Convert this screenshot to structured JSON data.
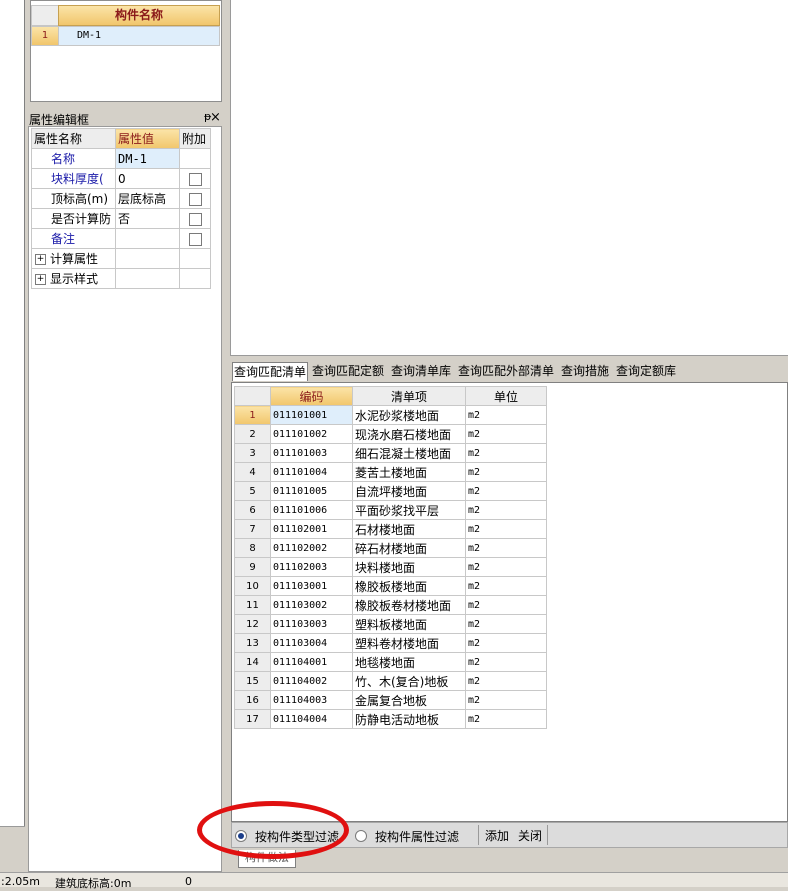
{
  "component_list": {
    "header": "构件名称",
    "rows": [
      {
        "num": "1",
        "name": "DM-1"
      }
    ]
  },
  "property_editor": {
    "title": "属性编辑框",
    "pin_glyph": "ᵽ",
    "close_glyph": "×",
    "col_name": "属性名称",
    "col_value": "属性值",
    "col_extra": "附加",
    "rows": [
      {
        "name": "名称",
        "value": "DM-1"
      },
      {
        "name": "块料厚度(",
        "value": "0"
      },
      {
        "name": "顶标高(m)",
        "value": "层底标高"
      },
      {
        "name": "是否计算防",
        "value": "否"
      },
      {
        "name": "备注",
        "value": ""
      }
    ],
    "groups": [
      {
        "label": "计算属性"
      },
      {
        "label": "显示样式"
      }
    ]
  },
  "query_tabs": [
    "查询匹配清单",
    "查询匹配定额",
    "查询清单库",
    "查询匹配外部清单",
    "查询措施",
    "查询定额库"
  ],
  "bill_table": {
    "headers": {
      "code": "编码",
      "item": "清单项",
      "unit": "单位"
    },
    "rows": [
      {
        "num": "1",
        "code": "011101001",
        "item": "水泥砂浆楼地面",
        "unit": "m2"
      },
      {
        "num": "2",
        "code": "011101002",
        "item": "现浇水磨石楼地面",
        "unit": "m2"
      },
      {
        "num": "3",
        "code": "011101003",
        "item": "细石混凝土楼地面",
        "unit": "m2"
      },
      {
        "num": "4",
        "code": "011101004",
        "item": "菱苦土楼地面",
        "unit": "m2"
      },
      {
        "num": "5",
        "code": "011101005",
        "item": "自流坪楼地面",
        "unit": "m2"
      },
      {
        "num": "6",
        "code": "011101006",
        "item": "平面砂浆找平层",
        "unit": "m2"
      },
      {
        "num": "7",
        "code": "011102001",
        "item": "石材楼地面",
        "unit": "m2"
      },
      {
        "num": "8",
        "code": "011102002",
        "item": "碎石材楼地面",
        "unit": "m2"
      },
      {
        "num": "9",
        "code": "011102003",
        "item": "块料楼地面",
        "unit": "m2"
      },
      {
        "num": "10",
        "code": "011103001",
        "item": "橡胶板楼地面",
        "unit": "m2"
      },
      {
        "num": "11",
        "code": "011103002",
        "item": "橡胶板卷材楼地面",
        "unit": "m2"
      },
      {
        "num": "12",
        "code": "011103003",
        "item": "塑料板楼地面",
        "unit": "m2"
      },
      {
        "num": "13",
        "code": "011103004",
        "item": "塑料卷材楼地面",
        "unit": "m2"
      },
      {
        "num": "14",
        "code": "011104001",
        "item": "地毯楼地面",
        "unit": "m2"
      },
      {
        "num": "15",
        "code": "011104002",
        "item": "竹、木(复合)地板",
        "unit": "m2"
      },
      {
        "num": "16",
        "code": "011104003",
        "item": "金属复合地板",
        "unit": "m2"
      },
      {
        "num": "17",
        "code": "011104004",
        "item": "防静电活动地板",
        "unit": "m2"
      }
    ]
  },
  "filter_bar": {
    "radio_type": "按构件类型过滤",
    "radio_attr": "按构件属性过滤",
    "add": "添加",
    "close": "关闭"
  },
  "bottom_tab": "构件做法",
  "status_bar": {
    "left_value": ":2.05m",
    "base_elevation": "建筑底标高:0m",
    "count": "0"
  },
  "colors": {
    "header_gold": "#f1c66c",
    "annotation_red": "#e01010",
    "label_blue": "#1a1aa8"
  }
}
